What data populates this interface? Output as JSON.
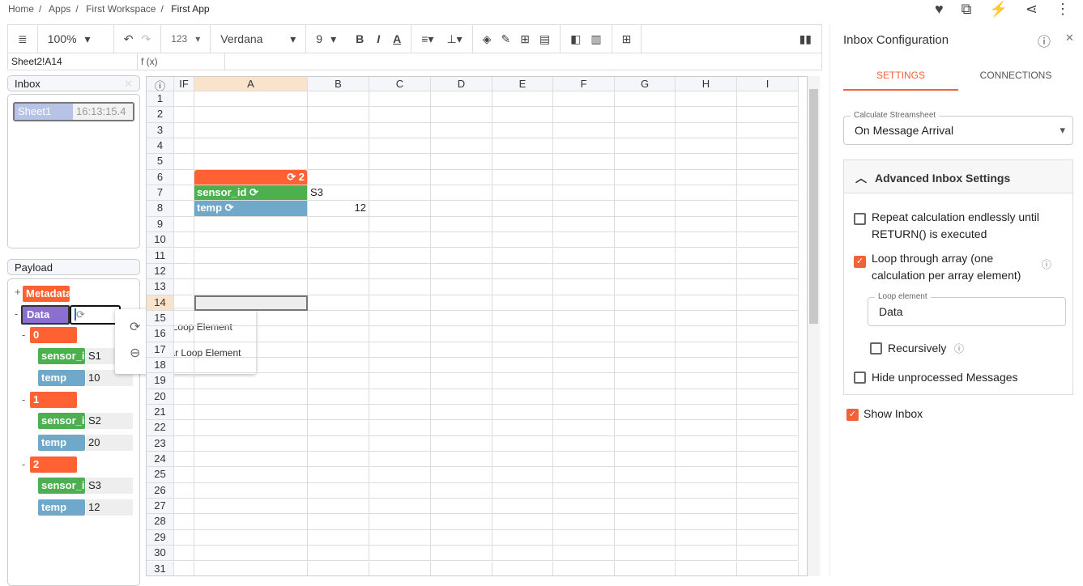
{
  "breadcrumb": [
    "Home",
    "Apps",
    "First Workspace",
    "First App"
  ],
  "toolbar": {
    "zoom": "100%",
    "number_format": "123",
    "font": "Verdana",
    "font_size": "9"
  },
  "formula_bar": {
    "cell_ref": "Sheet2!A14",
    "fx": "f (x)",
    "value": ""
  },
  "inbox": {
    "title": "Inbox",
    "message": {
      "sheet": "Sheet1",
      "time": "16:13:15.4"
    }
  },
  "payload": {
    "title": "Payload",
    "metadata": "Metadata",
    "data": "Data",
    "items": [
      {
        "index": "0",
        "sensor_id": "S1",
        "temp": "10"
      },
      {
        "index": "1",
        "sensor_id": "S2",
        "temp": "20"
      },
      {
        "index": "2",
        "sensor_id": "S3",
        "temp": "12"
      }
    ],
    "sensor_label": "sensor_id",
    "temp_label": "temp"
  },
  "context_menu": {
    "set": "Set Loop Element",
    "clear": "Clear Loop Element"
  },
  "sheet": {
    "columns": [
      "IF",
      "A",
      "B",
      "C",
      "D",
      "E",
      "F",
      "G",
      "H",
      "I"
    ],
    "row_count": 32,
    "selected_row": 14,
    "selected_col": "A",
    "cells": {
      "loop_header": "2",
      "sensor_label": "sensor_id",
      "sensor_value": "S3",
      "temp_label": "temp",
      "temp_value": "12"
    }
  },
  "right_panel": {
    "title": "Inbox Configuration",
    "tabs": [
      "SETTINGS",
      "CONNECTIONS"
    ],
    "active_tab": "SETTINGS",
    "calc_label": "Calculate Streamsheet",
    "calc_value": "On Message Arrival",
    "advanced_title": "Advanced Inbox Settings",
    "repeat": {
      "label": "Repeat calculation endlessly until RETURN() is executed",
      "checked": false
    },
    "loop": {
      "label": "Loop through array (one calculation per array element)",
      "checked": true
    },
    "loop_element_label": "Loop element",
    "loop_element_value": "Data",
    "recursively": {
      "label": "Recursively",
      "checked": false
    },
    "hide": {
      "label": "Hide unprocessed Messages",
      "checked": false
    },
    "show_inbox": {
      "label": "Show Inbox",
      "checked": true
    }
  },
  "colors": {
    "accent": "#f0633a",
    "orange": "#ff6133",
    "green": "#4caf50",
    "blue": "#6fa8c8",
    "purple": "#8a6fd1"
  }
}
